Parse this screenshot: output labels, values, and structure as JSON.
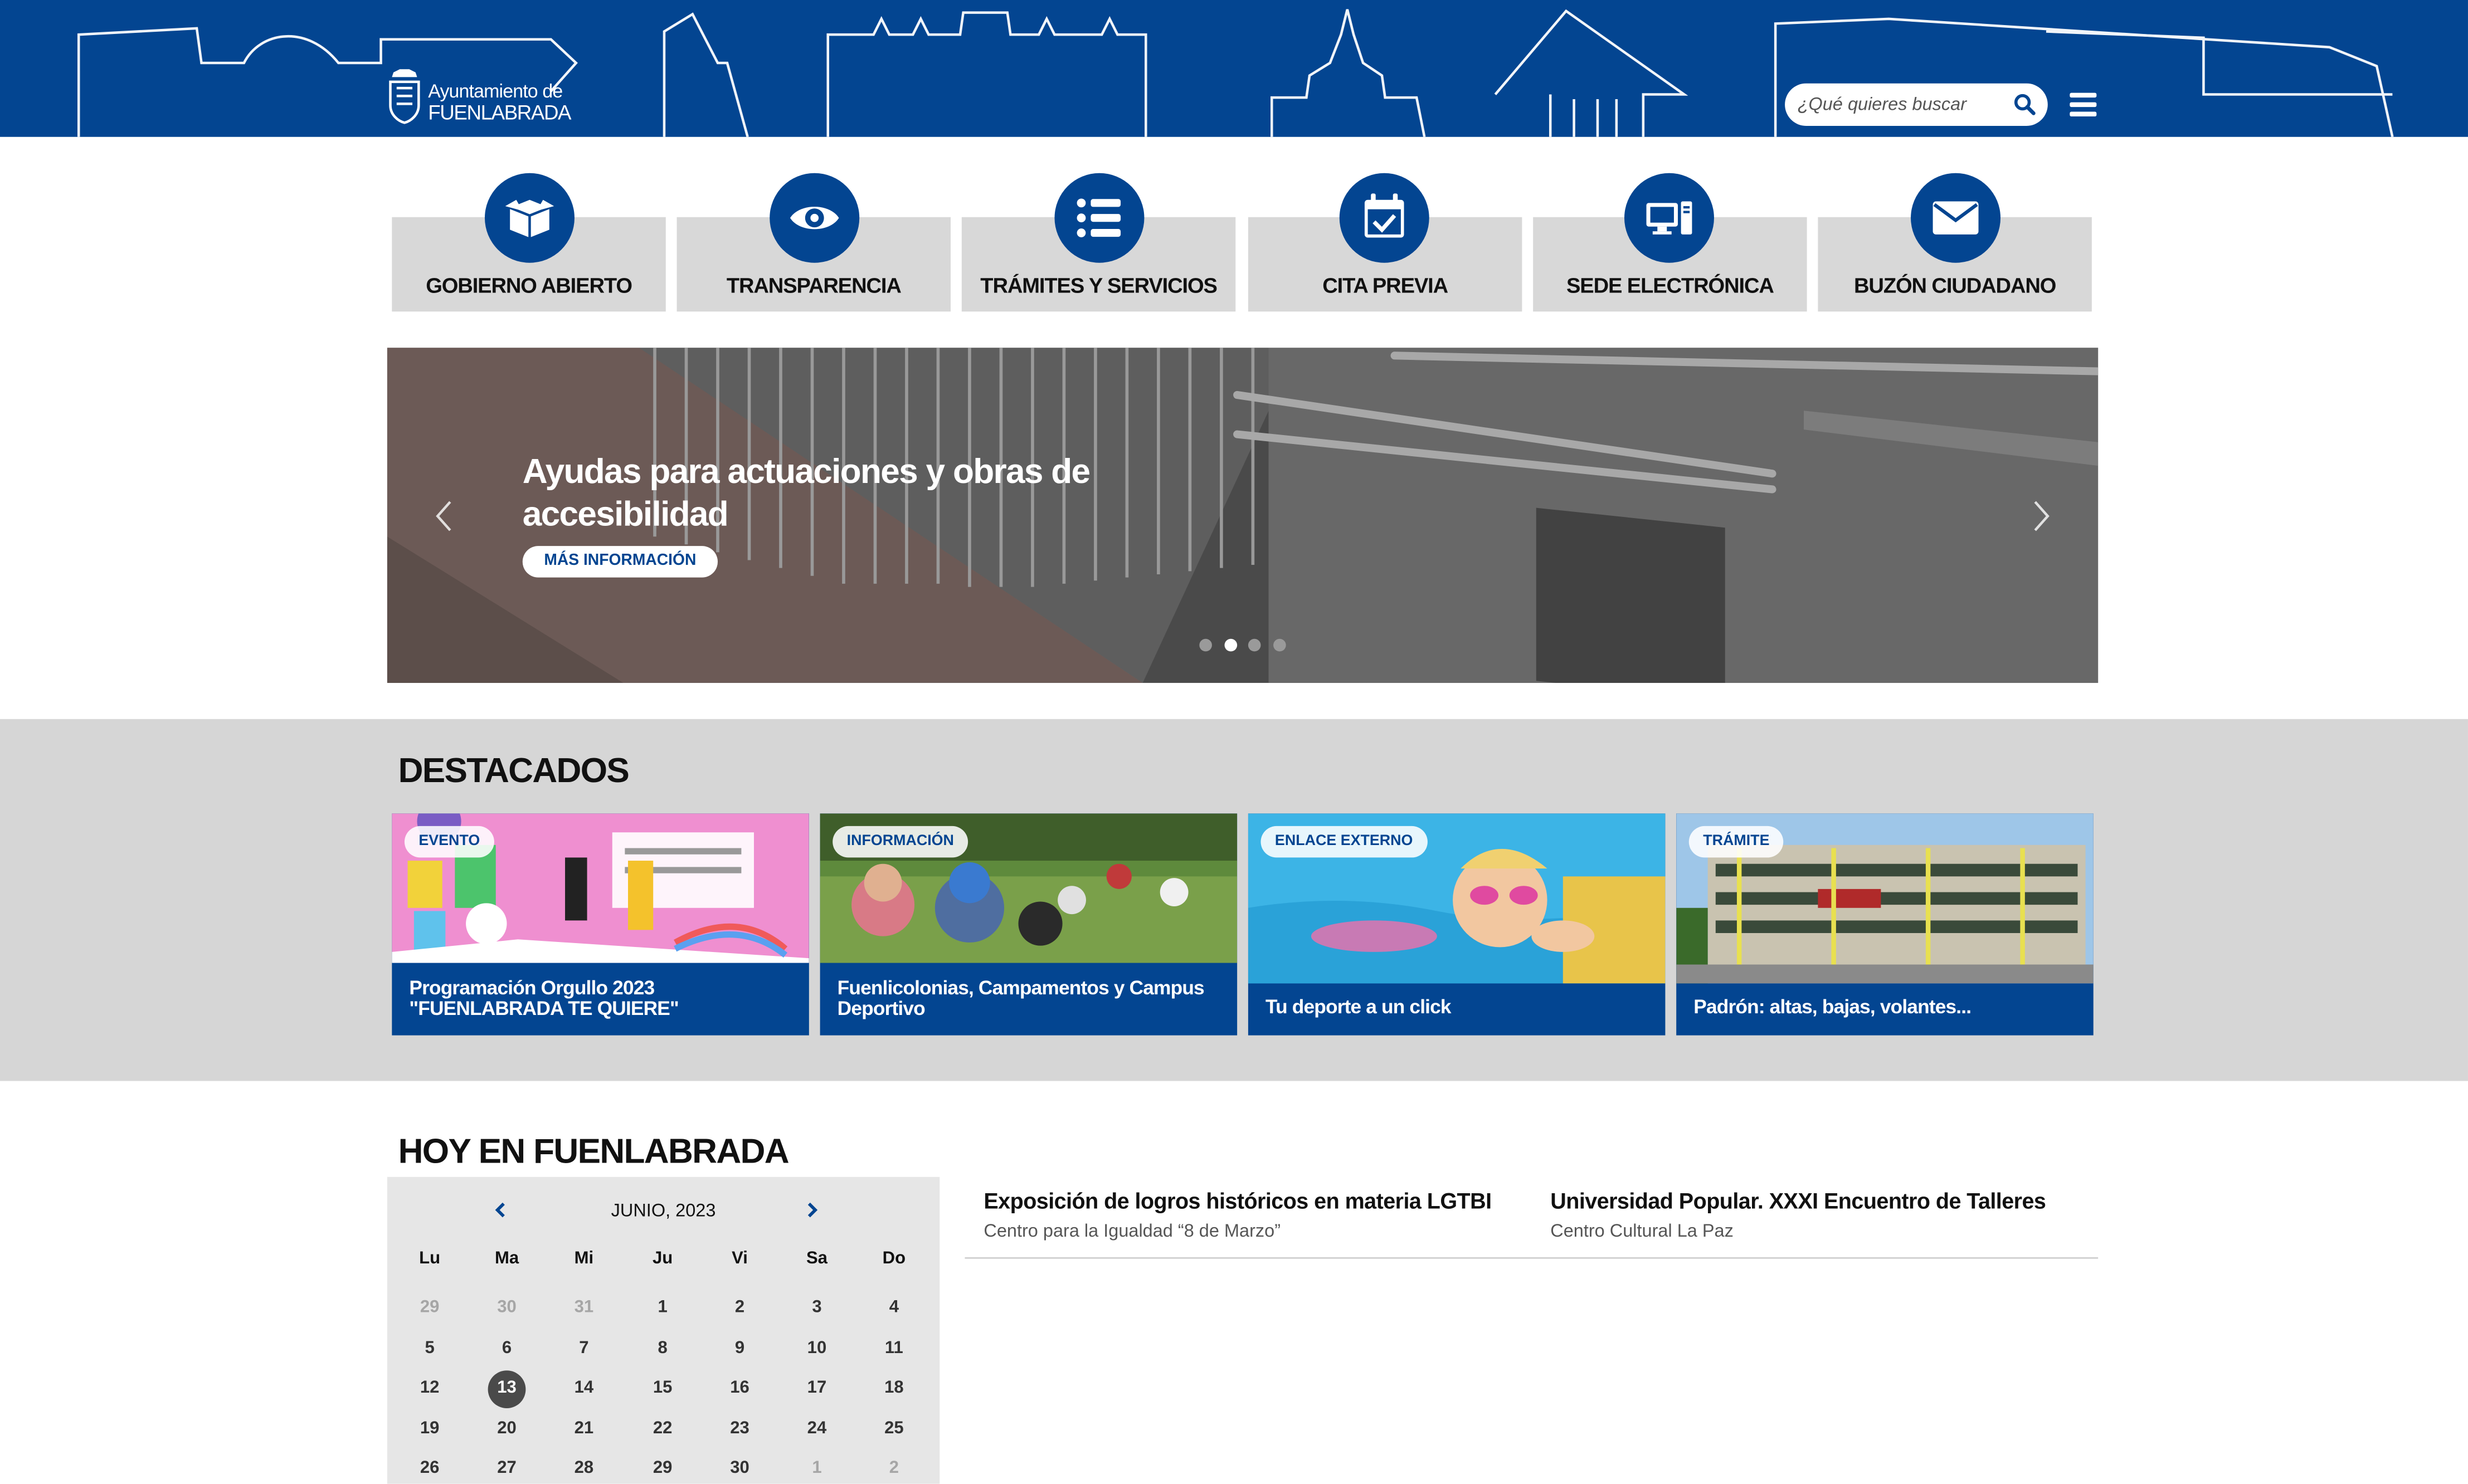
{
  "header": {
    "logo_line1": "Ayuntamiento de",
    "logo_line2": "FUENLABRADA",
    "search_placeholder": "¿Qué quieres buscar",
    "brand_color": "#034591"
  },
  "quick_links": [
    {
      "label": "GOBIERNO ABIERTO",
      "icon": "box-icon"
    },
    {
      "label": "TRANSPARENCIA",
      "icon": "eye-icon"
    },
    {
      "label": "TRÁMITES Y SERVICIOS",
      "icon": "list-icon"
    },
    {
      "label": "CITA PREVIA",
      "icon": "calendar-check-icon"
    },
    {
      "label": "SEDE ELECTRÓNICA",
      "icon": "computer-icon"
    },
    {
      "label": "BUZÓN CIUDADANO",
      "icon": "envelope-icon"
    }
  ],
  "carousel": {
    "title": "Ayudas para actuaciones y obras de accesibilidad",
    "button": "MÁS INFORMACIÓN",
    "slide_count": 4,
    "active_slide": 2
  },
  "destacados": {
    "title": "DESTACADOS",
    "cards": [
      {
        "badge": "EVENTO",
        "title": "Programación Orgullo 2023 \"FUENLABRADA TE QUIERE\""
      },
      {
        "badge": "INFORMACIÓN",
        "title": "Fuenlicolonias, Campamentos y Campus Deportivo"
      },
      {
        "badge": "ENLACE EXTERNO",
        "title": "Tu deporte a un click"
      },
      {
        "badge": "TRÁMITE",
        "title": "Padrón: altas, bajas, volantes..."
      }
    ]
  },
  "hoy": {
    "title": "HOY EN FUENLABRADA",
    "calendar": {
      "month": "JUNIO, 2023",
      "weekdays": [
        "Lu",
        "Ma",
        "Mi",
        "Ju",
        "Vi",
        "Sa",
        "Do"
      ],
      "weeks": [
        [
          "29",
          "30",
          "31",
          "1",
          "2",
          "3",
          "4"
        ],
        [
          "5",
          "6",
          "7",
          "8",
          "9",
          "10",
          "11"
        ],
        [
          "12",
          "13",
          "14",
          "15",
          "16",
          "17",
          "18"
        ],
        [
          "19",
          "20",
          "21",
          "22",
          "23",
          "24",
          "25"
        ],
        [
          "26",
          "27",
          "28",
          "29",
          "30",
          "1",
          "2"
        ]
      ],
      "today": "13"
    },
    "events": [
      {
        "title": "Exposición de logros históricos en materia LGTBI",
        "place": "Centro para la Igualdad “8 de Marzo”"
      },
      {
        "title": "Universidad Popular. XXXI Encuentro de Talleres",
        "place": "Centro Cultural La Paz"
      }
    ]
  }
}
